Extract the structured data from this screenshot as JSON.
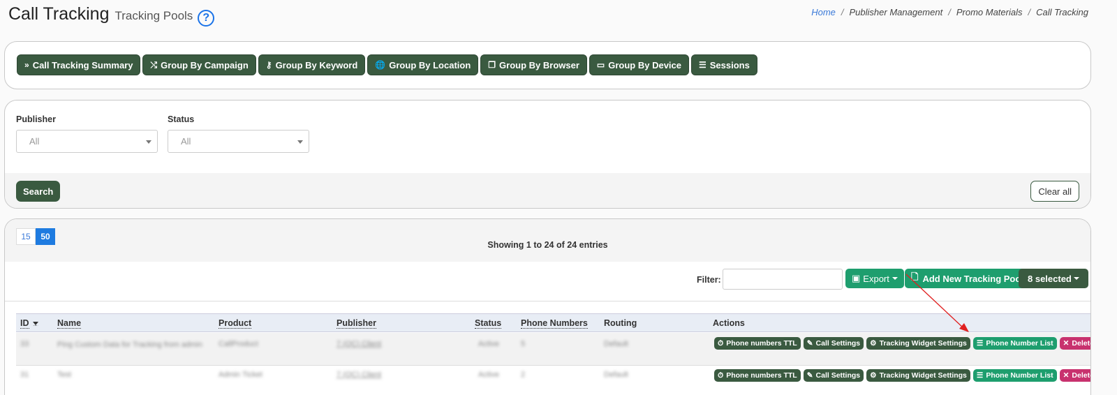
{
  "header": {
    "title": "Call Tracking",
    "subtitle": "Tracking Pools",
    "help_glyph": "?",
    "breadcrumb": [
      "Home",
      "Publisher Management",
      "Promo Materials",
      "Call Tracking"
    ]
  },
  "group_buttons": [
    {
      "label": "Call Tracking Summary",
      "icon": "double-chevron-right-icon",
      "glyph": "»"
    },
    {
      "label": "Group By Campaign",
      "icon": "shuffle-icon",
      "glyph": "⤭"
    },
    {
      "label": "Group By Keyword",
      "icon": "key-icon",
      "glyph": "⚷"
    },
    {
      "label": "Group By Location",
      "icon": "globe-icon",
      "glyph": "🌐"
    },
    {
      "label": "Group By Browser",
      "icon": "window-icon",
      "glyph": "❐"
    },
    {
      "label": "Group By Device",
      "icon": "laptop-icon",
      "glyph": "▭"
    },
    {
      "label": "Sessions",
      "icon": "list-icon",
      "glyph": "☰"
    }
  ],
  "filters": {
    "publisher_label": "Publisher",
    "publisher_value": "All",
    "status_label": "Status",
    "status_value": "All",
    "search_label": "Search",
    "clear_label": "Clear all"
  },
  "table_controls": {
    "page_sizes": [
      "15",
      "50"
    ],
    "active_page_size": "50",
    "showing": "Showing 1 to 24 of 24 entries",
    "filter_label": "Filter:",
    "export_label": "Export",
    "add_pool_label": "Add New Tracking Pool",
    "selected_label": "8 selected"
  },
  "table": {
    "columns": [
      "ID",
      "Name",
      "Product",
      "Publisher",
      "Status",
      "Phone Numbers",
      "Routing",
      "Actions"
    ],
    "rows": [
      {
        "id": "33",
        "name": "Ping Custom Data for Tracking from admin",
        "product": "CallProduct",
        "publisher": "7 (QC) Client",
        "status": "Active",
        "phone_numbers": "5",
        "routing": "Default"
      },
      {
        "id": "31",
        "name": "Test",
        "product": "Admin Ticket",
        "publisher": "7 (QC) Client",
        "status": "Active",
        "phone_numbers": "2",
        "routing": "Default"
      }
    ],
    "actions": [
      {
        "label": "Phone numbers TTL",
        "icon": "stopwatch-icon",
        "glyph": "⏱",
        "style": "dark"
      },
      {
        "label": "Call Settings",
        "icon": "pencil-icon",
        "glyph": "✎",
        "style": "dark"
      },
      {
        "label": "Tracking Widget Settings",
        "icon": "cogs-icon",
        "glyph": "⚙",
        "style": "dark"
      },
      {
        "label": "Phone Number List",
        "icon": "list-icon",
        "glyph": "☰",
        "style": "green"
      },
      {
        "label": "Delete",
        "icon": "close-icon",
        "glyph": "✕",
        "style": "red"
      }
    ]
  },
  "colors": {
    "primary_dark": "#3a5a40",
    "primary_green": "#1e9e6e",
    "danger": "#c8326e",
    "link": "#3a79d8",
    "annotation_arrow": "#e02020"
  }
}
